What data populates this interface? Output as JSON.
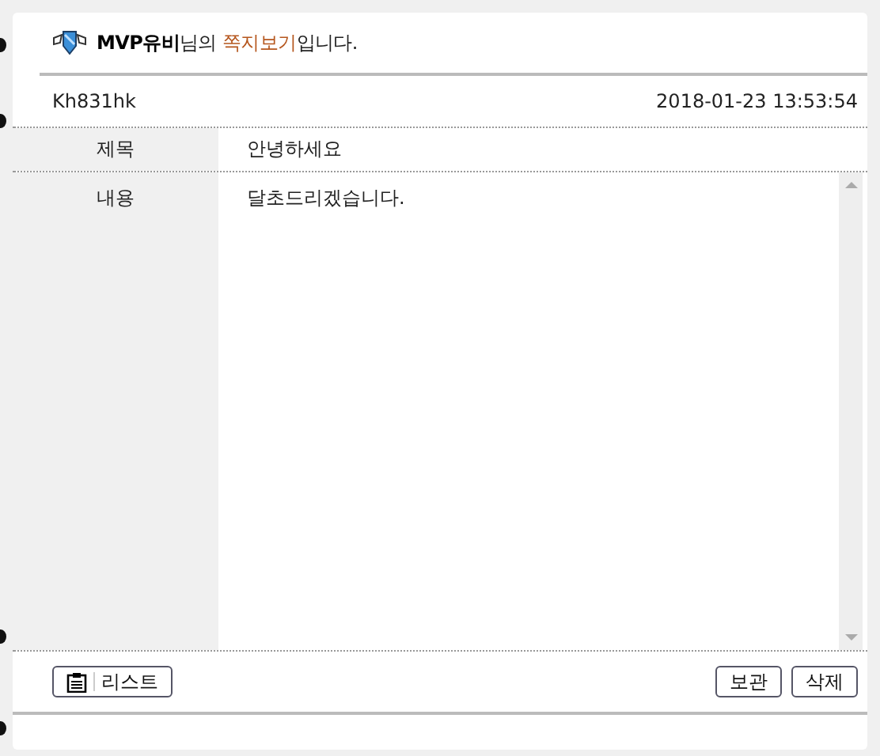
{
  "title": [
    {
      "text": "MVP유비",
      "kind": "name"
    },
    {
      "text": "님의 ",
      "kind": "plain"
    },
    {
      "text": "쪽지보기",
      "kind": "highlight"
    },
    {
      "text": "입니다.",
      "kind": "plain"
    }
  ],
  "sender": "Kh831hk",
  "date": "2018-01-23 13:53:54",
  "fields": [
    {
      "label": "제목",
      "kind": "line",
      "value": "안녕하세요"
    },
    {
      "label": "내용",
      "kind": "area",
      "value": "달초드리겠습니다."
    }
  ],
  "buttons_left": [
    {
      "label": "리스트",
      "kind": "list"
    }
  ],
  "buttons_right": [
    {
      "label": "보관"
    },
    {
      "label": "삭제"
    }
  ]
}
